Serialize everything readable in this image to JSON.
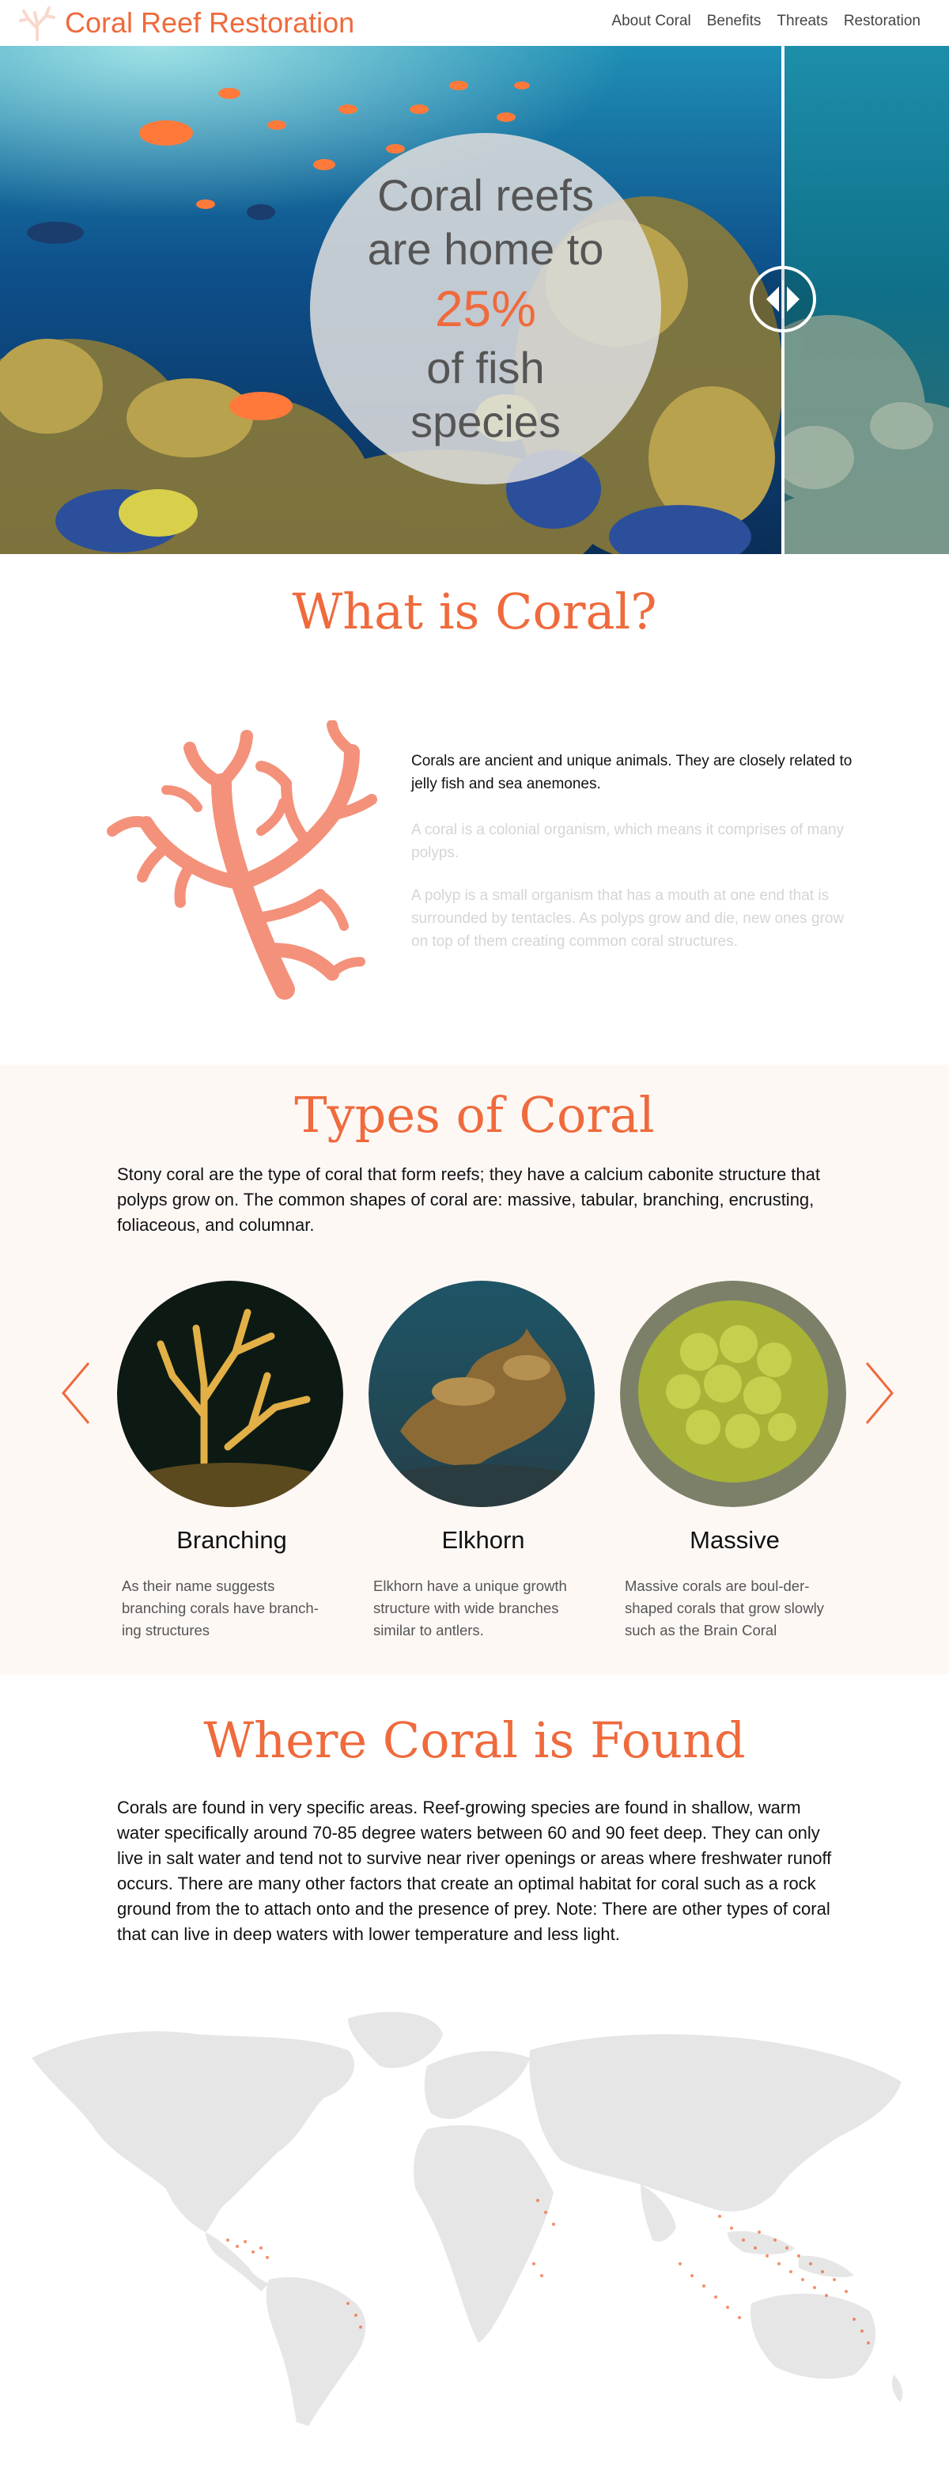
{
  "header": {
    "brand": "Coral Reef Restoration",
    "logo_icon": "coral-logo-icon",
    "nav": [
      {
        "label": "About Coral"
      },
      {
        "label": "Benefits"
      },
      {
        "label": "Threats"
      },
      {
        "label": "Restoration"
      }
    ]
  },
  "hero": {
    "stat_line1": "Coral reefs",
    "stat_line2": "are home to",
    "stat_value": "25%",
    "stat_line4": "of fish",
    "stat_line5": "species",
    "slider_icon": "compare-slider-icon"
  },
  "what_is_coral": {
    "heading": "What is Coral?",
    "paragraphs": [
      "Corals are ancient and unique animals. They are closely related to jelly fish and sea anemones.",
      "A coral is a colonial organism, which means it comprises of many polyps.",
      "A polyp is a small organism that has a mouth at one end that is surrounded by tentacles. As polyps grow and die, new ones grow on top of them creating common coral structures."
    ]
  },
  "types_of_coral": {
    "heading": "Types of Coral",
    "intro": "Stony coral are the type of coral that form reefs; they have a calcium cabonite structure that polyps grow on.  The common shapes of coral are: massive, tabular, branching, encrusting, foliaceous, and columnar.",
    "cards": [
      {
        "name": "Branching",
        "description": "As their name suggests branching corals have branch-ing structures"
      },
      {
        "name": "Elkhorn",
        "description": "Elkhorn have a unique growth structure with wide branches similar to antlers."
      },
      {
        "name": "Massive",
        "description": "Massive corals are boul-der-shaped corals that grow slowly such as the Brain Coral"
      }
    ]
  },
  "where_found": {
    "heading": "Where Coral is Found",
    "text": "Corals are found in very specific areas. Reef-growing species are found in shallow, warm water specifically around 70-85 degree waters between 60 and 90 feet deep. They can only live in salt water and tend not to survive near river openings or areas where freshwater runoff occurs. There are many other factors that create an optimal habitat for coral such as a rock ground from the to attach onto and the presence of prey. Note: There are other types of coral that can live in deep waters with lower temperature and less light."
  },
  "colors": {
    "accent": "#ef6a3c",
    "coral_illustration": "#f4917a",
    "section_bg": "#fef8f5",
    "map_land": "#e6e6e6"
  }
}
